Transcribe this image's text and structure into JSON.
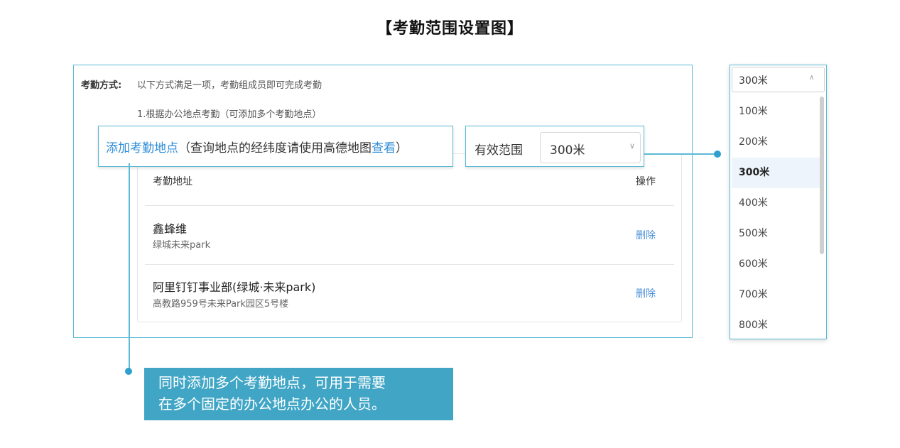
{
  "page_title": "【考勤范围设置图】",
  "attendance_mode": {
    "label": "考勤方式:",
    "description": "以下方式满足一项，考勤组成员即可完成考勤",
    "rule_1": "1.根据办公地点考勤（可添加多个考勤地点）"
  },
  "add_location": {
    "link_label": "添加考勤地点",
    "hint_prefix": "（查询地点的经纬度请使用高德地图",
    "view_link": "查看",
    "hint_suffix": "）"
  },
  "valid_range": {
    "label": "有效范围",
    "selected": "300米"
  },
  "table": {
    "col_address": "考勤地址",
    "col_operation": "操作",
    "rows": [
      {
        "name": "鑫蜂维",
        "address": "绿城未来park",
        "action": "删除"
      },
      {
        "name": "阿里钉钉事业部(绿城·未来park)",
        "address": "高教路959号未来Park园区5号楼",
        "action": "删除"
      }
    ]
  },
  "dropdown": {
    "current": "300米",
    "options": [
      "100米",
      "200米",
      "300米",
      "400米",
      "500米",
      "600米",
      "700米",
      "800米"
    ],
    "selected_option": "300米"
  },
  "note": {
    "line1": "同时添加多个考勤地点，可用于需要",
    "line2": "在多个固定的办公地点办公的人员。"
  },
  "colors": {
    "accent": "#5bbad5",
    "link": "#2e8dd8",
    "note_bg": "#41a6c6"
  }
}
